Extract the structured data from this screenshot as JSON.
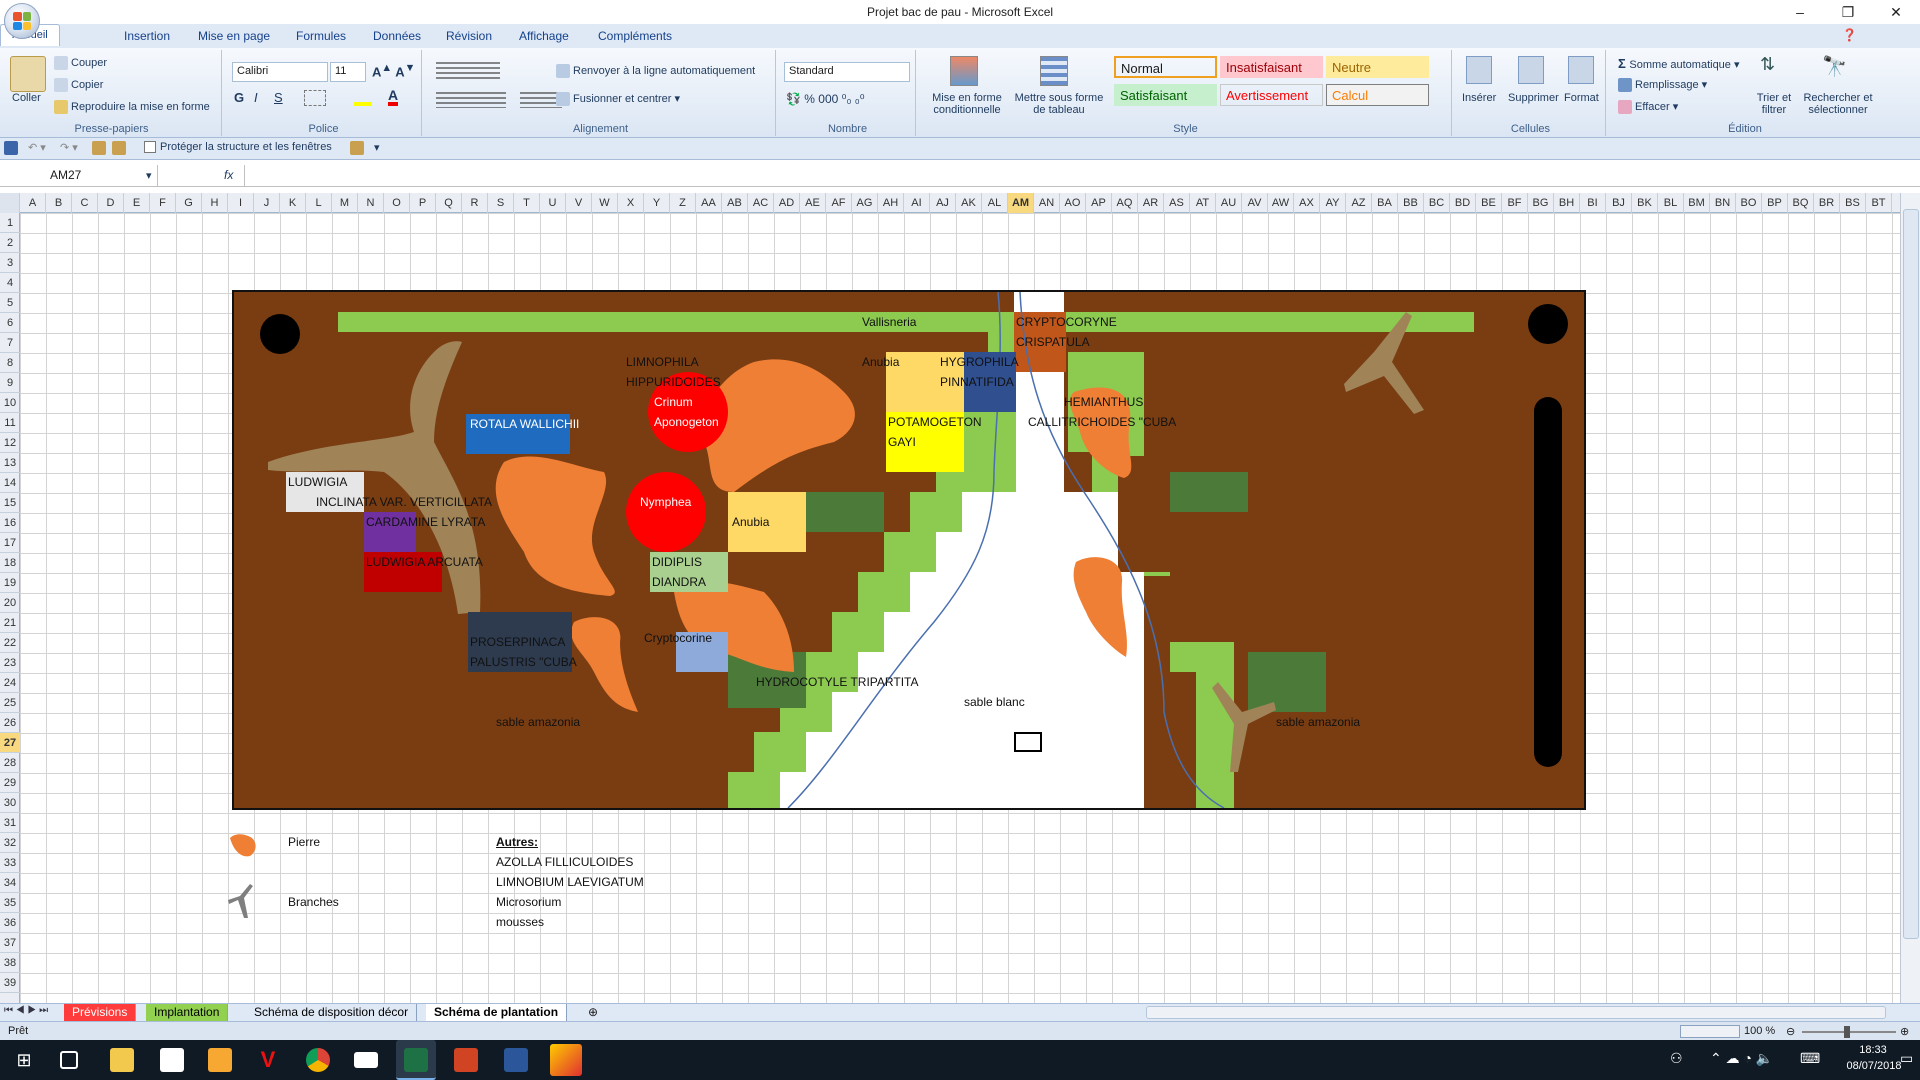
{
  "window": {
    "title": "Projet bac de pau - Microsoft Excel"
  },
  "ribbon_tabs": [
    "Accueil",
    "Insertion",
    "Mise en page",
    "Formules",
    "Données",
    "Révision",
    "Affichage",
    "Compléments"
  ],
  "clipboard": {
    "paste": "Coller",
    "cut": "Couper",
    "copy": "Copier",
    "format_painter": "Reproduire la mise en forme",
    "label": "Presse-papiers"
  },
  "font": {
    "name": "Calibri",
    "size": "11",
    "label": "Police"
  },
  "alignment": {
    "wrap": "Renvoyer à la ligne automatiquement",
    "merge": "Fusionner et centrer",
    "label": "Alignement"
  },
  "number": {
    "format": "Standard",
    "label": "Nombre"
  },
  "styles": {
    "cond_format": "Mise en forme conditionnelle",
    "table_format": "Mettre sous forme de tableau",
    "label": "Style",
    "items": [
      {
        "name": "Normal",
        "bg": "#ffffff",
        "fg": "#000000"
      },
      {
        "name": "Insatisfaisant",
        "bg": "#ffc7ce",
        "fg": "#9c0006"
      },
      {
        "name": "Neutre",
        "bg": "#ffeb9c",
        "fg": "#9c6500"
      },
      {
        "name": "Satisfaisant",
        "bg": "#c6efce",
        "fg": "#006100"
      },
      {
        "name": "Avertissement",
        "bg": "#ffffff",
        "fg": "#ff0000"
      },
      {
        "name": "Calcul",
        "bg": "#f2f2f2",
        "fg": "#fa7d00"
      }
    ]
  },
  "cells": {
    "insert": "Insérer",
    "delete": "Supprimer",
    "format": "Format",
    "label": "Cellules"
  },
  "editing": {
    "autosum": "Somme automatique",
    "fill": "Remplissage",
    "clear": "Effacer",
    "sort": "Trier et filtrer",
    "find": "Rechercher et sélectionner",
    "label": "Édition"
  },
  "qat": {
    "protect": "Protéger la structure et les fenêtres"
  },
  "formula": {
    "namebox": "AM27",
    "fx": "fx",
    "value": ""
  },
  "columns": [
    "A",
    "B",
    "C",
    "D",
    "E",
    "F",
    "G",
    "H",
    "I",
    "J",
    "K",
    "L",
    "M",
    "N",
    "O",
    "P",
    "Q",
    "R",
    "S",
    "T",
    "U",
    "V",
    "W",
    "X",
    "Y",
    "Z",
    "AA",
    "AB",
    "AC",
    "AD",
    "AE",
    "AF",
    "AG",
    "AH",
    "AI",
    "AJ",
    "AK",
    "AL",
    "AM",
    "AN",
    "AO",
    "AP",
    "AQ",
    "AR",
    "AS",
    "AT",
    "AU",
    "AV",
    "AW",
    "AX",
    "AY",
    "AZ",
    "BA",
    "BB",
    "BC",
    "BD",
    "BE",
    "BF",
    "BG",
    "BH",
    "BI",
    "BJ",
    "BK",
    "BL",
    "BM",
    "BN",
    "BO",
    "BP",
    "BQ",
    "BR",
    "BS",
    "BT"
  ],
  "active_column": "AM",
  "active_row": "27",
  "rows": [
    "1",
    "2",
    "3",
    "4",
    "5",
    "6",
    "7",
    "8",
    "9",
    "10",
    "11",
    "12",
    "13",
    "14",
    "15",
    "16",
    "17",
    "18",
    "19",
    "20",
    "21",
    "22",
    "23",
    "24",
    "25",
    "26",
    "27",
    "28",
    "29",
    "30",
    "31",
    "32",
    "33",
    "34",
    "35",
    "36",
    "37",
    "38",
    "39"
  ],
  "plants": {
    "vallisneria": "Vallisneria",
    "cryptocoryne_1": "CRYPTOCORYNE",
    "cryptocoryne_2": "CRISPATULA",
    "limnophila_1": "LIMNOPHILA",
    "limnophila_2": "HIPPURIDOIDES",
    "crinum_1": "Crinum",
    "crinum_2": "Aponogeton",
    "anubia_top": "Anubia",
    "hygrophila_1": "HYGROPHILA",
    "hygrophila_2": "PINNATIFIDA",
    "hemianthus_1": "HEMIANTHUS",
    "hemianthus_2": "CALLITRICHOIDES \"CUBA",
    "rotala": "ROTALA WALLICHII",
    "potamogeton_1": "POTAMOGETON",
    "potamogeton_2": "GAYI",
    "ludwigia_1": "LUDWIGIA",
    "ludwigia_2": "INCLINATA VAR. VERTICILLATA",
    "cardamine": "CARDAMINE LYRATA",
    "ludwigia_red": "LUDWIGIA ARCUATA",
    "nymphea": "Nymphea",
    "anubia_mid": "Anubia",
    "didiplis_1": "DIDIPLIS",
    "didiplis_2": "DIANDRA",
    "proserpinaca_1": "PROSERPINACA",
    "proserpinaca_2": "PALUSTRIS \"CUBA",
    "cryptocorine": "Cryptocorine",
    "hydrocotyle": "HYDROCOTYLE TRIPARTITA",
    "sable_blanc": "sable blanc",
    "sable_amazonia_left": "sable amazonia",
    "sable_amazonia_right": "sable amazonia"
  },
  "legend": {
    "pierre": "Pierre",
    "branches": "Branches",
    "autres_title": "Autres:",
    "autres": [
      "AZOLLA FILLICULOIDES",
      "LIMNOBIUM LAEVIGATUM",
      "Microsorium",
      "mousses"
    ]
  },
  "sheets": [
    "Prévisions",
    "Implantation",
    "Schéma de disposition décor",
    "Schéma de plantation"
  ],
  "status": {
    "left": "Prêt",
    "zoom": "100 %"
  },
  "clock": {
    "time": "18:33",
    "date": "08/07/2018"
  }
}
